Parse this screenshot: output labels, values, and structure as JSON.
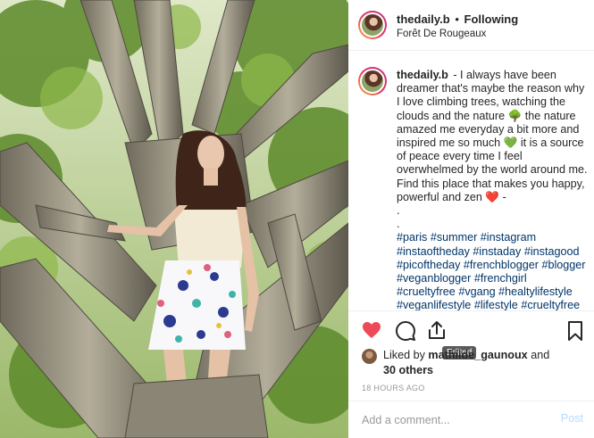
{
  "post": {
    "header": {
      "username": "thedaily.b",
      "separator": "•",
      "follow_status": "Following",
      "location": "Forêt De Rougeaux"
    },
    "caption": {
      "username": "thedaily.b",
      "text": "- I always have been dreamer that's maybe the reason why I love climbing trees, watching the clouds and the nature 🌳 the nature amazed me everyday a bit more and inspired me so much 💚 it is a source of peace every time I feel overwhelmed by the world around me.\nFind this place that makes you happy, powerful and zen ❤️ -\n.\n.",
      "hashtags": [
        "#paris",
        "#summer",
        "#instagram",
        "#instaoftheday",
        "#instaday",
        "#instagood",
        "#picoftheday",
        "#frenchblogger",
        "#blogger",
        "#veganblogger",
        "#frenchgirl",
        "#crueltyfree",
        "#vgang",
        "#healtylifestyle",
        "#veganlifestyle",
        "#lifestyle",
        "#crueltyfree"
      ]
    },
    "edited_tooltip": "Edited",
    "actions": {
      "like_icon": "heart-filled-icon",
      "comment_icon": "comment-bubble-icon",
      "share_icon": "share-upload-icon",
      "save_icon": "bookmark-icon",
      "like_color": "#ed4956"
    },
    "likes": {
      "prefix": "Liked by",
      "user": "mathilde_gaunoux",
      "conjunction": "and",
      "others": "30 others"
    },
    "timestamp": "18 HOURS AGO",
    "comment_box": {
      "placeholder": "Add a comment...",
      "post_label": "Post"
    }
  }
}
